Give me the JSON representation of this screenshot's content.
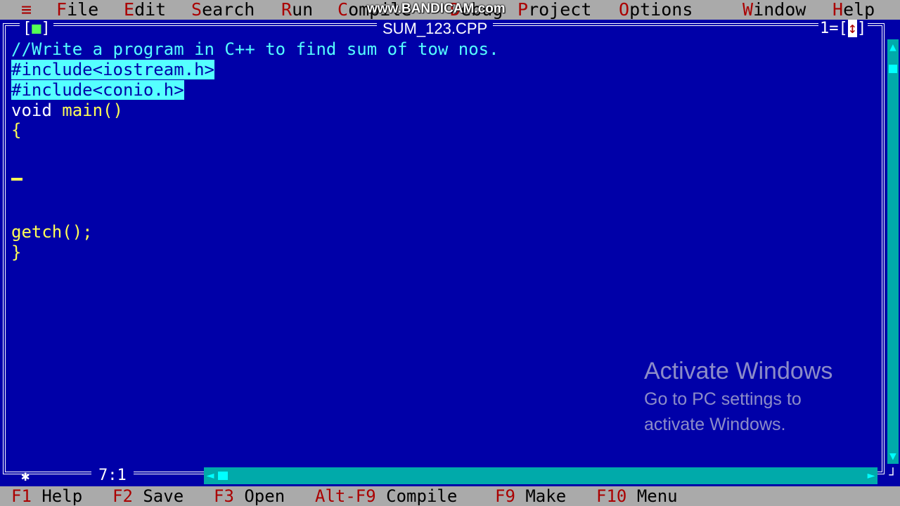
{
  "menubar": {
    "system_glyph": "≡",
    "items": [
      {
        "hot": "F",
        "rest": "ile"
      },
      {
        "hot": "E",
        "rest": "dit"
      },
      {
        "hot": "S",
        "rest": "earch"
      },
      {
        "hot": "R",
        "rest": "un"
      },
      {
        "hot": "C",
        "rest": "ompile"
      },
      {
        "hot": "D",
        "rest": "ebug"
      },
      {
        "hot": "P",
        "rest": "roject"
      },
      {
        "hot": "O",
        "rest": "ptions"
      },
      {
        "hot": "W",
        "rest": "indow"
      },
      {
        "hot": "H",
        "rest": "elp"
      }
    ]
  },
  "watermark": "www.BANDICAM.com",
  "editor": {
    "close_box_left": "[",
    "close_box_inner": "■",
    "close_box_right": "]",
    "file_name": "SUM_123.CPP",
    "window_number": "1=",
    "zoom_left": "[",
    "zoom_arrow": "↕",
    "zoom_right": "]",
    "cursor_position": "7:1",
    "lines": {
      "comment": "//Write a program in C++ to find sum of tow nos.",
      "include1": "#include<iostream.h>",
      "include2": "#include<conio.h>",
      "main_kw": "void",
      "main_name": " main()",
      "open_brace": "{",
      "getch": "getch();",
      "close_brace": "}"
    }
  },
  "scroll": {
    "up_arrow": "▲",
    "down_arrow": "▼",
    "left_arrow": "◄",
    "right_arrow": "►",
    "resize": "┘"
  },
  "fkeys": [
    {
      "key": "F1",
      "desc": "Help"
    },
    {
      "key": "F2",
      "desc": "Save"
    },
    {
      "key": "F3",
      "desc": "Open"
    },
    {
      "key": "Alt-F9",
      "desc": "Compile"
    },
    {
      "key": "F9",
      "desc": "Make"
    },
    {
      "key": "F10",
      "desc": "Menu"
    }
  ],
  "activation": {
    "headline": "Activate Windows",
    "line1": "Go to PC settings to",
    "line2": "activate Windows."
  },
  "colors": {
    "background": "#0000a8",
    "menu_bg": "#aaaaaa",
    "hotkey": "#aa0000",
    "comment": "#55ffff",
    "identifier": "#ffff55"
  }
}
